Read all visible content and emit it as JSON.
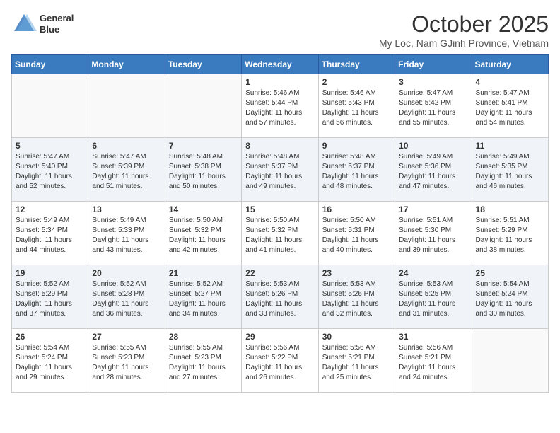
{
  "header": {
    "logo_line1": "General",
    "logo_line2": "Blue",
    "month": "October 2025",
    "location": "My Loc, Nam GJinh Province, Vietnam"
  },
  "weekdays": [
    "Sunday",
    "Monday",
    "Tuesday",
    "Wednesday",
    "Thursday",
    "Friday",
    "Saturday"
  ],
  "weeks": [
    [
      {
        "day": "",
        "detail": "",
        "empty": true
      },
      {
        "day": "",
        "detail": "",
        "empty": true
      },
      {
        "day": "",
        "detail": "",
        "empty": true
      },
      {
        "day": "1",
        "detail": "Sunrise: 5:46 AM\nSunset: 5:44 PM\nDaylight: 11 hours\nand 57 minutes.",
        "empty": false
      },
      {
        "day": "2",
        "detail": "Sunrise: 5:46 AM\nSunset: 5:43 PM\nDaylight: 11 hours\nand 56 minutes.",
        "empty": false
      },
      {
        "day": "3",
        "detail": "Sunrise: 5:47 AM\nSunset: 5:42 PM\nDaylight: 11 hours\nand 55 minutes.",
        "empty": false
      },
      {
        "day": "4",
        "detail": "Sunrise: 5:47 AM\nSunset: 5:41 PM\nDaylight: 11 hours\nand 54 minutes.",
        "empty": false
      }
    ],
    [
      {
        "day": "5",
        "detail": "Sunrise: 5:47 AM\nSunset: 5:40 PM\nDaylight: 11 hours\nand 52 minutes.",
        "empty": false,
        "shaded": true
      },
      {
        "day": "6",
        "detail": "Sunrise: 5:47 AM\nSunset: 5:39 PM\nDaylight: 11 hours\nand 51 minutes.",
        "empty": false,
        "shaded": true
      },
      {
        "day": "7",
        "detail": "Sunrise: 5:48 AM\nSunset: 5:38 PM\nDaylight: 11 hours\nand 50 minutes.",
        "empty": false,
        "shaded": true
      },
      {
        "day": "8",
        "detail": "Sunrise: 5:48 AM\nSunset: 5:37 PM\nDaylight: 11 hours\nand 49 minutes.",
        "empty": false,
        "shaded": true
      },
      {
        "day": "9",
        "detail": "Sunrise: 5:48 AM\nSunset: 5:37 PM\nDaylight: 11 hours\nand 48 minutes.",
        "empty": false,
        "shaded": true
      },
      {
        "day": "10",
        "detail": "Sunrise: 5:49 AM\nSunset: 5:36 PM\nDaylight: 11 hours\nand 47 minutes.",
        "empty": false,
        "shaded": true
      },
      {
        "day": "11",
        "detail": "Sunrise: 5:49 AM\nSunset: 5:35 PM\nDaylight: 11 hours\nand 46 minutes.",
        "empty": false,
        "shaded": true
      }
    ],
    [
      {
        "day": "12",
        "detail": "Sunrise: 5:49 AM\nSunset: 5:34 PM\nDaylight: 11 hours\nand 44 minutes.",
        "empty": false
      },
      {
        "day": "13",
        "detail": "Sunrise: 5:49 AM\nSunset: 5:33 PM\nDaylight: 11 hours\nand 43 minutes.",
        "empty": false
      },
      {
        "day": "14",
        "detail": "Sunrise: 5:50 AM\nSunset: 5:32 PM\nDaylight: 11 hours\nand 42 minutes.",
        "empty": false
      },
      {
        "day": "15",
        "detail": "Sunrise: 5:50 AM\nSunset: 5:32 PM\nDaylight: 11 hours\nand 41 minutes.",
        "empty": false
      },
      {
        "day": "16",
        "detail": "Sunrise: 5:50 AM\nSunset: 5:31 PM\nDaylight: 11 hours\nand 40 minutes.",
        "empty": false
      },
      {
        "day": "17",
        "detail": "Sunrise: 5:51 AM\nSunset: 5:30 PM\nDaylight: 11 hours\nand 39 minutes.",
        "empty": false
      },
      {
        "day": "18",
        "detail": "Sunrise: 5:51 AM\nSunset: 5:29 PM\nDaylight: 11 hours\nand 38 minutes.",
        "empty": false
      }
    ],
    [
      {
        "day": "19",
        "detail": "Sunrise: 5:52 AM\nSunset: 5:29 PM\nDaylight: 11 hours\nand 37 minutes.",
        "empty": false,
        "shaded": true
      },
      {
        "day": "20",
        "detail": "Sunrise: 5:52 AM\nSunset: 5:28 PM\nDaylight: 11 hours\nand 36 minutes.",
        "empty": false,
        "shaded": true
      },
      {
        "day": "21",
        "detail": "Sunrise: 5:52 AM\nSunset: 5:27 PM\nDaylight: 11 hours\nand 34 minutes.",
        "empty": false,
        "shaded": true
      },
      {
        "day": "22",
        "detail": "Sunrise: 5:53 AM\nSunset: 5:26 PM\nDaylight: 11 hours\nand 33 minutes.",
        "empty": false,
        "shaded": true
      },
      {
        "day": "23",
        "detail": "Sunrise: 5:53 AM\nSunset: 5:26 PM\nDaylight: 11 hours\nand 32 minutes.",
        "empty": false,
        "shaded": true
      },
      {
        "day": "24",
        "detail": "Sunrise: 5:53 AM\nSunset: 5:25 PM\nDaylight: 11 hours\nand 31 minutes.",
        "empty": false,
        "shaded": true
      },
      {
        "day": "25",
        "detail": "Sunrise: 5:54 AM\nSunset: 5:24 PM\nDaylight: 11 hours\nand 30 minutes.",
        "empty": false,
        "shaded": true
      }
    ],
    [
      {
        "day": "26",
        "detail": "Sunrise: 5:54 AM\nSunset: 5:24 PM\nDaylight: 11 hours\nand 29 minutes.",
        "empty": false
      },
      {
        "day": "27",
        "detail": "Sunrise: 5:55 AM\nSunset: 5:23 PM\nDaylight: 11 hours\nand 28 minutes.",
        "empty": false
      },
      {
        "day": "28",
        "detail": "Sunrise: 5:55 AM\nSunset: 5:23 PM\nDaylight: 11 hours\nand 27 minutes.",
        "empty": false
      },
      {
        "day": "29",
        "detail": "Sunrise: 5:56 AM\nSunset: 5:22 PM\nDaylight: 11 hours\nand 26 minutes.",
        "empty": false
      },
      {
        "day": "30",
        "detail": "Sunrise: 5:56 AM\nSunset: 5:21 PM\nDaylight: 11 hours\nand 25 minutes.",
        "empty": false
      },
      {
        "day": "31",
        "detail": "Sunrise: 5:56 AM\nSunset: 5:21 PM\nDaylight: 11 hours\nand 24 minutes.",
        "empty": false
      },
      {
        "day": "",
        "detail": "",
        "empty": true
      }
    ]
  ]
}
